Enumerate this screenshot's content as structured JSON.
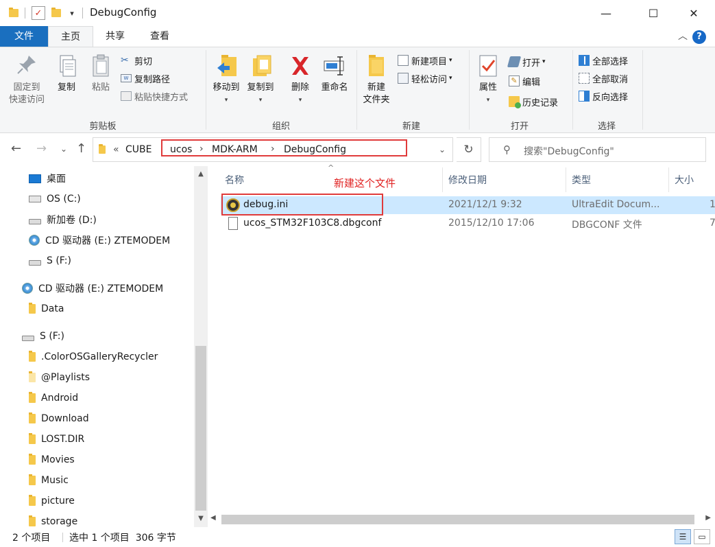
{
  "window": {
    "title": "DebugConfig"
  },
  "quick_access": {
    "dropdown_glyph": "▾"
  },
  "window_controls": {
    "minimize": "—",
    "maximize": "☐",
    "close": "✕"
  },
  "tabs": [
    {
      "label": "文件"
    },
    {
      "label": "主页"
    },
    {
      "label": "共享"
    },
    {
      "label": "查看"
    }
  ],
  "ribbon": {
    "clipboard": {
      "group_label": "剪贴板",
      "pin": "固定到\n快速访问",
      "pin_line1": "固定到",
      "pin_line2": "快速访问",
      "copy": "复制",
      "paste": "粘贴",
      "cut": "剪切",
      "copy_path": "复制路径",
      "paste_shortcut": "粘贴快捷方式"
    },
    "organize": {
      "group_label": "组织",
      "move_to": "移动到",
      "copy_to": "复制到",
      "delete": "删除",
      "rename": "重命名"
    },
    "new": {
      "group_label": "新建",
      "new_folder_line1": "新建",
      "new_folder_line2": "文件夹",
      "new_item": "新建项目",
      "easy_access": "轻松访问"
    },
    "open": {
      "group_label": "打开",
      "properties": "属性",
      "open": "打开",
      "edit": "编辑",
      "history": "历史记录"
    },
    "select": {
      "group_label": "选择",
      "select_all": "全部选择",
      "select_none": "全部取消",
      "invert": "反向选择"
    }
  },
  "address": {
    "overflow": "«",
    "crumbs": [
      "CUBE",
      "ucos",
      "MDK-ARM",
      "DebugConfig"
    ],
    "separator": "›",
    "search_placeholder": "搜索\"DebugConfig\""
  },
  "nav_pane": {
    "items": [
      {
        "label": "桌面",
        "icon": "desktop-icon"
      },
      {
        "label": "OS (C:)",
        "icon": "os-drive-icon"
      },
      {
        "label": "新加卷 (D:)",
        "icon": "drive-icon"
      },
      {
        "label": "CD 驱动器 (E:) ZTEMODEM",
        "icon": "cd-drive-icon"
      },
      {
        "label": "S (F:)",
        "icon": "drive-icon"
      },
      {
        "label": "CD 驱动器 (E:) ZTEMODEM",
        "icon": "cd-drive-icon"
      },
      {
        "label": "Data",
        "icon": "folder-icon"
      },
      {
        "label": "S (F:)",
        "icon": "drive-icon"
      },
      {
        "label": ".ColorOSGalleryRecycler",
        "icon": "folder-icon"
      },
      {
        "label": "@Playlists",
        "icon": "folder-icon"
      },
      {
        "label": "Android",
        "icon": "folder-icon"
      },
      {
        "label": "Download",
        "icon": "folder-icon"
      },
      {
        "label": "LOST.DIR",
        "icon": "folder-icon"
      },
      {
        "label": "Movies",
        "icon": "folder-icon"
      },
      {
        "label": "Music",
        "icon": "folder-icon"
      },
      {
        "label": "picture",
        "icon": "folder-icon"
      },
      {
        "label": "storage",
        "icon": "folder-icon"
      }
    ]
  },
  "file_list": {
    "columns": [
      "名称",
      "修改日期",
      "类型",
      "大小"
    ],
    "annotation": "新建这个文件",
    "rows": [
      {
        "name": "debug.ini",
        "modified": "2021/12/1 9:32",
        "type": "UltraEdit Docum...",
        "size": "1",
        "selected": true
      },
      {
        "name": "ucos_STM32F103C8.dbgconf",
        "modified": "2015/12/10 17:06",
        "type": "DBGCONF 文件",
        "size": "7",
        "selected": false
      }
    ]
  },
  "status": {
    "item_count": "2 个项目",
    "selection": "选中 1 个项目  306 字节"
  },
  "colors": {
    "file_tab": "#1a6fbf",
    "selection": "#cce8ff",
    "annotation": "#e02020"
  }
}
